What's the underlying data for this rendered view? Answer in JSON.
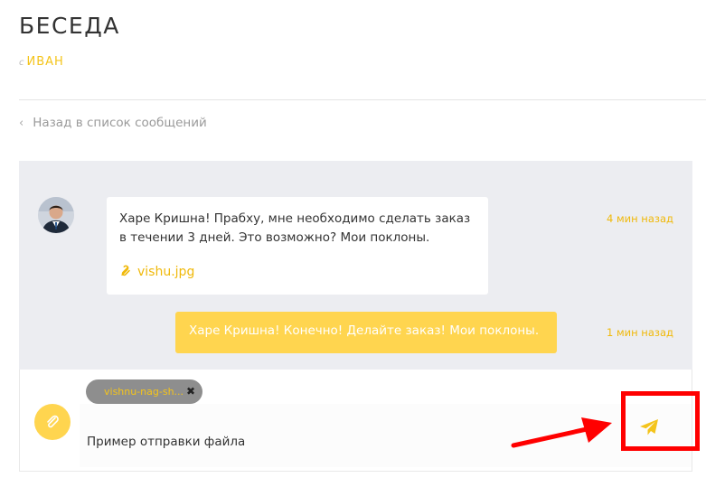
{
  "header": {
    "title": "БЕСЕДА",
    "with_prefix": "с",
    "with_name": "ИВАН"
  },
  "nav": {
    "back_label": "Назад в список сообщений",
    "back_icon": "chevron-left-icon"
  },
  "messages": [
    {
      "direction": "incoming",
      "avatar": "user-avatar",
      "text": "Харе Кришна! Прабху, мне необходимо сделать заказ в течении 3 дней. Это возможно? Мои поклоны.",
      "attachment": "vishu.jpg",
      "time": "4 мин назад"
    },
    {
      "direction": "outgoing",
      "text": "Харе Кришна! Конечно! Делайте заказ! Мои поклоны.",
      "time": "1 мин назад"
    }
  ],
  "composer": {
    "attached_file": "vishnu-nag-sh...",
    "input_value": "Пример отправки файла",
    "attach_icon": "paperclip-icon",
    "send_icon": "paper-plane-icon"
  },
  "colors": {
    "accent": "#f4c41b",
    "outgoing_bubble": "#ffd54f",
    "thread_bg": "#ecedf1",
    "annotation": "#ff0000"
  }
}
